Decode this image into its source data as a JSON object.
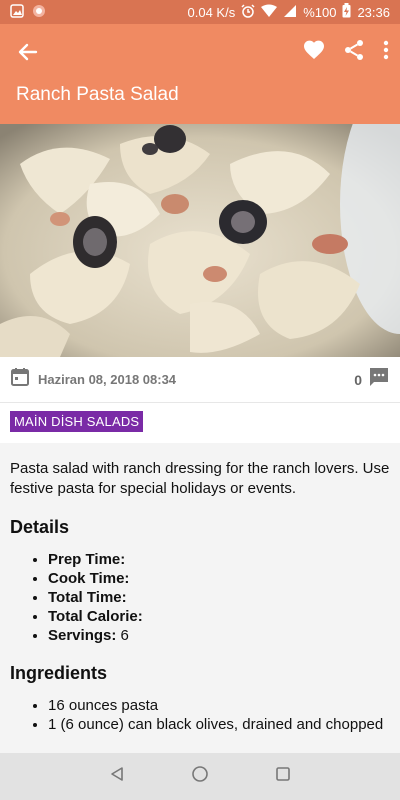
{
  "status_bar": {
    "network_speed": "0.04 K/s",
    "battery": "%100",
    "time": "23:36"
  },
  "app_bar": {
    "title": "Ranch Pasta Salad"
  },
  "meta": {
    "date": "Haziran 08, 2018 08:34",
    "comment_count": "0"
  },
  "category_tag": "MAİN DİSH SALADS",
  "description": "Pasta salad with ranch dressing for the ranch lovers. Use festive pasta for special holidays or events.",
  "details": {
    "heading": "Details",
    "items": [
      {
        "label": "Prep Time:",
        "value": ""
      },
      {
        "label": "Cook Time:",
        "value": ""
      },
      {
        "label": "Total Time:",
        "value": ""
      },
      {
        "label": "Total Calorie:",
        "value": ""
      },
      {
        "label": "Servings:",
        "value": "6"
      }
    ]
  },
  "ingredients": {
    "heading": "Ingredients",
    "items": [
      "16 ounces pasta",
      "1 (6 ounce) can black olives, drained and chopped"
    ]
  },
  "colors": {
    "app_bar": "#f08a62",
    "status_bar": "#d97452",
    "tag": "#7a2aa6"
  }
}
